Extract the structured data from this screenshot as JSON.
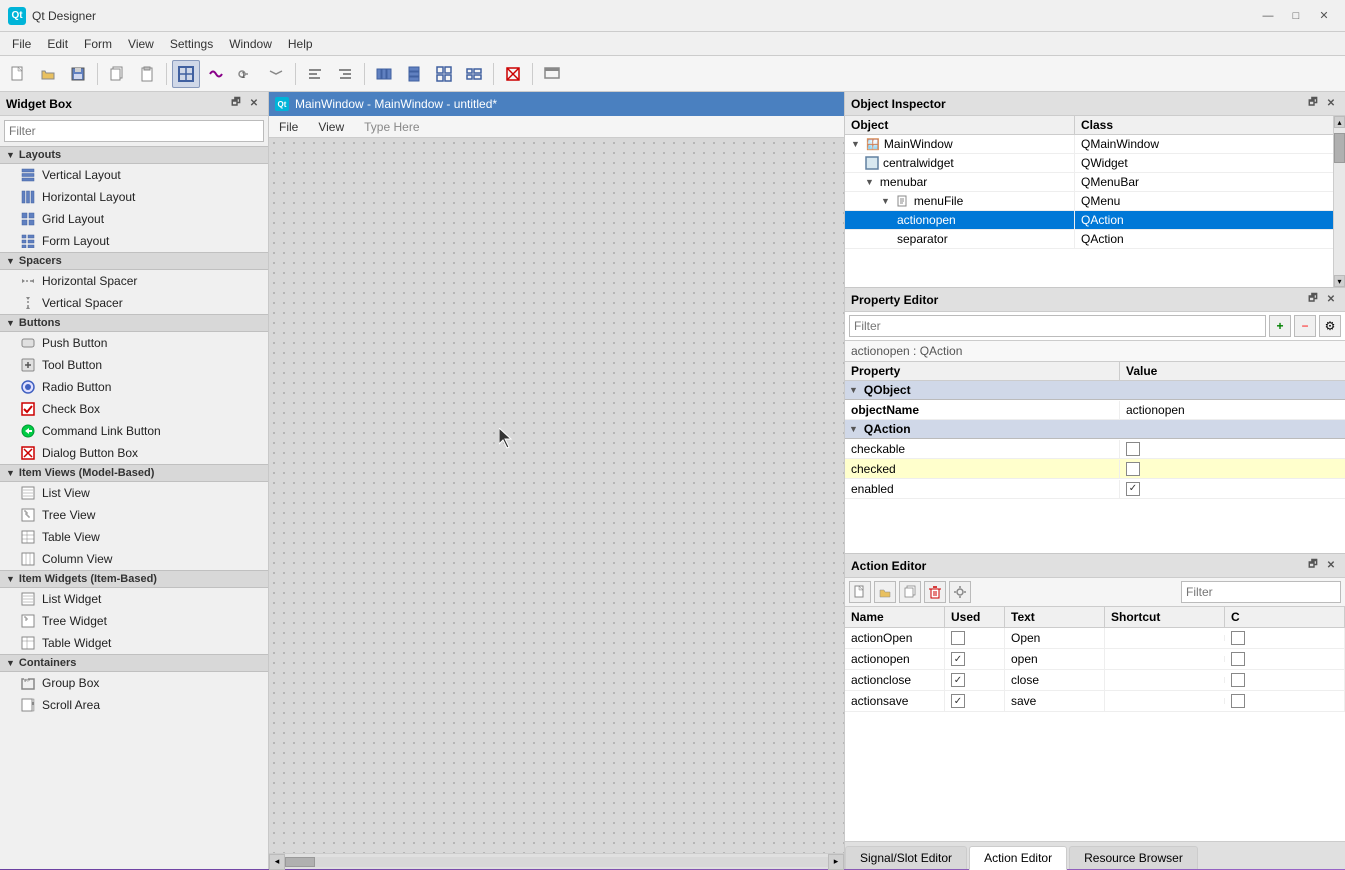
{
  "titleBar": {
    "appIcon": "Qt",
    "title": "Qt Designer",
    "controls": {
      "minimize": "—",
      "maximize": "□",
      "close": "✕"
    }
  },
  "menuBar": {
    "items": [
      "File",
      "Edit",
      "Form",
      "View",
      "Settings",
      "Window",
      "Help"
    ]
  },
  "toolbar": {
    "buttons": [
      {
        "name": "new",
        "icon": "📄"
      },
      {
        "name": "open",
        "icon": "📂"
      },
      {
        "name": "save",
        "icon": "💾"
      },
      {
        "name": "sep1",
        "type": "separator"
      },
      {
        "name": "copy",
        "icon": "📋"
      },
      {
        "name": "paste",
        "icon": "📌"
      },
      {
        "name": "sep2",
        "type": "separator"
      },
      {
        "name": "widget-edit",
        "icon": "⬛",
        "active": true
      },
      {
        "name": "signal-slot",
        "icon": "↔"
      },
      {
        "name": "tab-order",
        "icon": "⚡"
      },
      {
        "name": "buddy",
        "icon": "🔗"
      },
      {
        "name": "sep3",
        "type": "separator"
      },
      {
        "name": "align-left",
        "icon": "◫"
      },
      {
        "name": "align-center",
        "icon": "≡"
      },
      {
        "name": "sep4",
        "type": "separator"
      },
      {
        "name": "layout-h",
        "icon": "⊞"
      },
      {
        "name": "layout-v",
        "icon": "⊟"
      },
      {
        "name": "layout-g",
        "icon": "⊠"
      },
      {
        "name": "layout-f",
        "icon": "⊡"
      },
      {
        "name": "sep5",
        "type": "separator"
      },
      {
        "name": "break-layout",
        "icon": "✂"
      },
      {
        "name": "sep6",
        "type": "separator"
      },
      {
        "name": "preview",
        "icon": "👁"
      }
    ]
  },
  "widgetBox": {
    "title": "Widget Box",
    "filterPlaceholder": "Filter",
    "sections": [
      {
        "name": "Layouts",
        "expanded": true,
        "items": [
          {
            "label": "Vertical Layout",
            "icon": "⊟"
          },
          {
            "label": "Horizontal Layout",
            "icon": "⊞"
          },
          {
            "label": "Grid Layout",
            "icon": "⊠"
          },
          {
            "label": "Form Layout",
            "icon": "⊡"
          }
        ]
      },
      {
        "name": "Spacers",
        "expanded": true,
        "items": [
          {
            "label": "Horizontal Spacer",
            "icon": "↔"
          },
          {
            "label": "Vertical Spacer",
            "icon": "↕"
          }
        ]
      },
      {
        "name": "Buttons",
        "expanded": true,
        "items": [
          {
            "label": "Push Button",
            "icon": "🔘"
          },
          {
            "label": "Tool Button",
            "icon": "🔧"
          },
          {
            "label": "Radio Button",
            "icon": "🔵"
          },
          {
            "label": "Check Box",
            "icon": "☑"
          },
          {
            "label": "Command Link Button",
            "icon": "🔗"
          },
          {
            "label": "Dialog Button Box",
            "icon": "❎"
          }
        ]
      },
      {
        "name": "Item Views (Model-Based)",
        "expanded": true,
        "items": [
          {
            "label": "List View",
            "icon": "📋"
          },
          {
            "label": "Tree View",
            "icon": "🌲"
          },
          {
            "label": "Table View",
            "icon": "📊"
          },
          {
            "label": "Column View",
            "icon": "📑"
          }
        ]
      },
      {
        "name": "Item Widgets (Item-Based)",
        "expanded": true,
        "items": [
          {
            "label": "List Widget",
            "icon": "📋"
          },
          {
            "label": "Tree Widget",
            "icon": "🌲"
          },
          {
            "label": "Table Widget",
            "icon": "📊"
          }
        ]
      },
      {
        "name": "Containers",
        "expanded": true,
        "items": [
          {
            "label": "Group Box",
            "icon": "📦"
          },
          {
            "label": "Scroll Area",
            "icon": "📜"
          }
        ]
      }
    ]
  },
  "canvas": {
    "title": "MainWindow - MainWindow - untitled*",
    "menuItems": [
      "File",
      "View",
      "Type Here"
    ]
  },
  "objectInspector": {
    "title": "Object Inspector",
    "columns": [
      "Object",
      "Class"
    ],
    "rows": [
      {
        "level": 0,
        "hasExpand": true,
        "expanded": true,
        "object": "MainWindow",
        "class": "QMainWindow",
        "icon": "🪟"
      },
      {
        "level": 1,
        "hasExpand": false,
        "expanded": false,
        "object": "centralwidget",
        "class": "QWidget",
        "icon": "🔲"
      },
      {
        "level": 1,
        "hasExpand": true,
        "expanded": true,
        "object": "menubar",
        "class": "QMenuBar",
        "icon": "📋"
      },
      {
        "level": 2,
        "hasExpand": true,
        "expanded": true,
        "object": "menuFile",
        "class": "QMenu",
        "icon": "📄"
      },
      {
        "level": 3,
        "hasExpand": false,
        "expanded": false,
        "object": "actionopen",
        "class": "QAction",
        "icon": "⚡",
        "selected": true
      },
      {
        "level": 3,
        "hasExpand": false,
        "expanded": false,
        "object": "separator",
        "class": "QAction",
        "icon": "⚡"
      }
    ]
  },
  "propertyEditor": {
    "title": "Property Editor",
    "filterPlaceholder": "Filter",
    "contextLabel": "actionopen : QAction",
    "columns": [
      "Property",
      "Value"
    ],
    "sections": [
      {
        "name": "QObject",
        "rows": [
          {
            "property": "objectName",
            "value": "actionopen",
            "bold": true
          }
        ]
      },
      {
        "name": "QAction",
        "rows": [
          {
            "property": "checkable",
            "value": "",
            "type": "checkbox",
            "checked": false
          },
          {
            "property": "checked",
            "value": "",
            "type": "checkbox",
            "checked": false,
            "highlighted": true
          },
          {
            "property": "enabled",
            "value": "",
            "type": "checkbox",
            "checked": true
          }
        ]
      }
    ]
  },
  "actionEditor": {
    "title": "Action Editor",
    "filterPlaceholder": "Filter",
    "toolbar": {
      "buttons": [
        {
          "name": "new-action",
          "icon": "📄"
        },
        {
          "name": "open-action",
          "icon": "📂"
        },
        {
          "name": "copy-action",
          "icon": "📋"
        },
        {
          "name": "delete-action",
          "icon": "🗑"
        },
        {
          "name": "settings-action",
          "icon": "🔧"
        }
      ]
    },
    "columns": [
      "Name",
      "Used",
      "Text",
      "Shortcut",
      "Checkable"
    ],
    "rows": [
      {
        "name": "actionOpen",
        "used": false,
        "text": "Open",
        "shortcut": "",
        "checkable": false
      },
      {
        "name": "actionopen",
        "used": true,
        "text": "open",
        "shortcut": "",
        "checkable": false
      },
      {
        "name": "actionclose",
        "used": true,
        "text": "close",
        "shortcut": "",
        "checkable": false
      },
      {
        "name": "actionsave",
        "used": true,
        "text": "save",
        "shortcut": "",
        "checkable": false
      }
    ]
  },
  "bottomTabs": {
    "items": [
      {
        "label": "Signal/Slot Editor",
        "active": false
      },
      {
        "label": "Action Editor",
        "active": true
      },
      {
        "label": "Resource Browser",
        "active": false
      }
    ]
  }
}
